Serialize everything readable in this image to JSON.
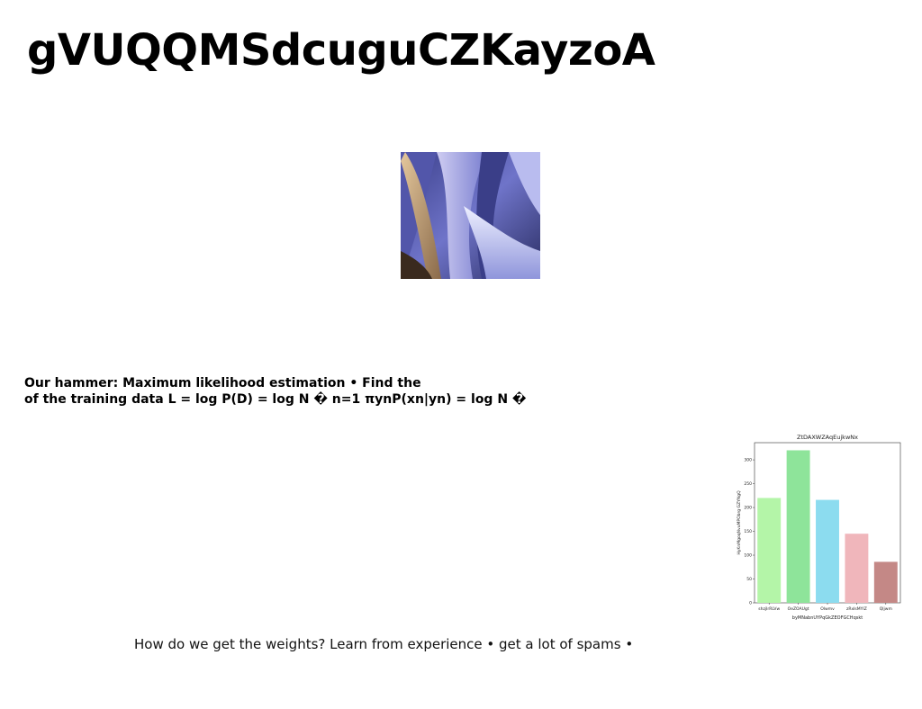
{
  "slide": {
    "title": "gVUQQMSdcuguCZKayzoA",
    "hammer_line1": "Our hammer: Maximum likelihood estimation • Find the",
    "hammer_line2": "of the training data L = log P(D) = log N � n=1 πynP(xn|yn) = log N �",
    "weights_text": "How do we get the weights? Learn from experience • get a lot of spams •"
  },
  "photo": {
    "icon": "abstract-purple-folds-image",
    "colors": [
      "#5a5fb8",
      "#8d90d8",
      "#c9c6ee",
      "#d9c2a0",
      "#2b2f6b"
    ]
  },
  "chart_data": {
    "type": "bar",
    "title": "ZtDAXWZAqEujkwNx",
    "xlabel": "byMNabnUYPqGkZEOFGCHqskt",
    "ylabel": "HyKnMgoqNvuMPObrg GZYNgQ",
    "categories": [
      "shzjIrRLVw",
      "OeZOAUgt",
      "Olwmv",
      "zRxIsMYIZ",
      "Qljwm"
    ],
    "values": [
      220,
      320,
      216,
      145,
      86
    ],
    "colors": [
      "#b4f5a8",
      "#8ee49a",
      "#8cdcef",
      "#f0b6bb",
      "#c48886"
    ],
    "ylim": [
      0,
      336
    ],
    "yticks": [
      0,
      50,
      100,
      150,
      200,
      250,
      300
    ],
    "grid": false
  }
}
